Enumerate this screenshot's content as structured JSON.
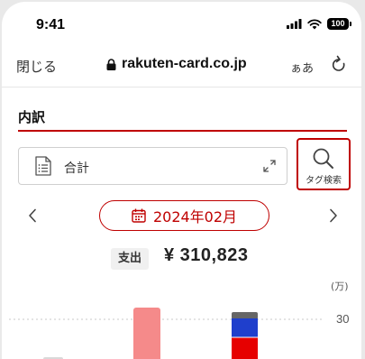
{
  "status_bar": {
    "time": "9:41",
    "battery": "100"
  },
  "browser": {
    "close_label": "閉じる",
    "url": "rakuten-card.co.jp",
    "text_size_label": "ぁあ"
  },
  "section": {
    "title": "内訳"
  },
  "category": {
    "label": "合計"
  },
  "tag_search": {
    "label": "タグ検索"
  },
  "month": {
    "label": "2024年02月"
  },
  "summary": {
    "badge": "支出",
    "amount": "¥ 310,823"
  },
  "colors": {
    "accent": "#bf0000",
    "bar_pink": "#f58a8a",
    "bar_blue": "#1f3fcc",
    "bar_red": "#e60000",
    "bar_gray": "#666666"
  },
  "chart_data": {
    "type": "bar",
    "unit_label": "(万)",
    "y_ticks": [
      "30"
    ],
    "stacked_segments_bar2_colors": [
      "#e60000",
      "#1f3fcc",
      "#666666"
    ]
  }
}
